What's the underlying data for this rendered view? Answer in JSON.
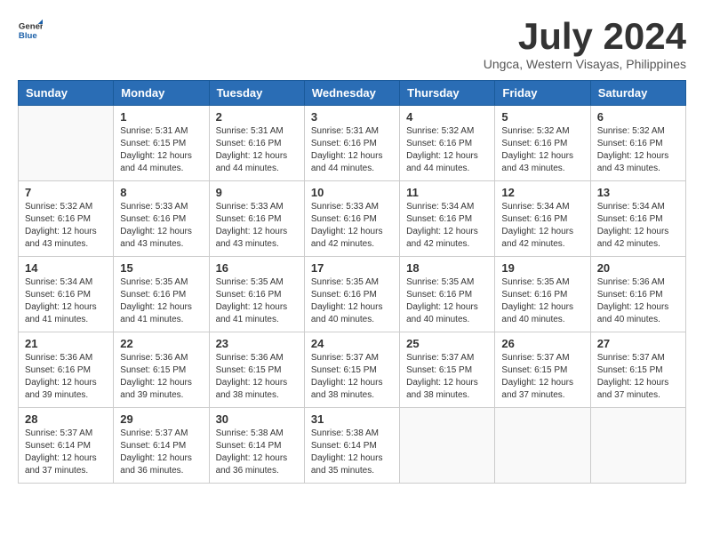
{
  "logo": {
    "line1": "General",
    "line2": "Blue"
  },
  "title": "July 2024",
  "location": "Ungca, Western Visayas, Philippines",
  "weekdays": [
    "Sunday",
    "Monday",
    "Tuesday",
    "Wednesday",
    "Thursday",
    "Friday",
    "Saturday"
  ],
  "weeks": [
    [
      {
        "day": "",
        "sunrise": "",
        "sunset": "",
        "daylight": ""
      },
      {
        "day": "1",
        "sunrise": "Sunrise: 5:31 AM",
        "sunset": "Sunset: 6:15 PM",
        "daylight": "Daylight: 12 hours and 44 minutes."
      },
      {
        "day": "2",
        "sunrise": "Sunrise: 5:31 AM",
        "sunset": "Sunset: 6:16 PM",
        "daylight": "Daylight: 12 hours and 44 minutes."
      },
      {
        "day": "3",
        "sunrise": "Sunrise: 5:31 AM",
        "sunset": "Sunset: 6:16 PM",
        "daylight": "Daylight: 12 hours and 44 minutes."
      },
      {
        "day": "4",
        "sunrise": "Sunrise: 5:32 AM",
        "sunset": "Sunset: 6:16 PM",
        "daylight": "Daylight: 12 hours and 44 minutes."
      },
      {
        "day": "5",
        "sunrise": "Sunrise: 5:32 AM",
        "sunset": "Sunset: 6:16 PM",
        "daylight": "Daylight: 12 hours and 43 minutes."
      },
      {
        "day": "6",
        "sunrise": "Sunrise: 5:32 AM",
        "sunset": "Sunset: 6:16 PM",
        "daylight": "Daylight: 12 hours and 43 minutes."
      }
    ],
    [
      {
        "day": "7",
        "sunrise": "Sunrise: 5:32 AM",
        "sunset": "Sunset: 6:16 PM",
        "daylight": "Daylight: 12 hours and 43 minutes."
      },
      {
        "day": "8",
        "sunrise": "Sunrise: 5:33 AM",
        "sunset": "Sunset: 6:16 PM",
        "daylight": "Daylight: 12 hours and 43 minutes."
      },
      {
        "day": "9",
        "sunrise": "Sunrise: 5:33 AM",
        "sunset": "Sunset: 6:16 PM",
        "daylight": "Daylight: 12 hours and 43 minutes."
      },
      {
        "day": "10",
        "sunrise": "Sunrise: 5:33 AM",
        "sunset": "Sunset: 6:16 PM",
        "daylight": "Daylight: 12 hours and 42 minutes."
      },
      {
        "day": "11",
        "sunrise": "Sunrise: 5:34 AM",
        "sunset": "Sunset: 6:16 PM",
        "daylight": "Daylight: 12 hours and 42 minutes."
      },
      {
        "day": "12",
        "sunrise": "Sunrise: 5:34 AM",
        "sunset": "Sunset: 6:16 PM",
        "daylight": "Daylight: 12 hours and 42 minutes."
      },
      {
        "day": "13",
        "sunrise": "Sunrise: 5:34 AM",
        "sunset": "Sunset: 6:16 PM",
        "daylight": "Daylight: 12 hours and 42 minutes."
      }
    ],
    [
      {
        "day": "14",
        "sunrise": "Sunrise: 5:34 AM",
        "sunset": "Sunset: 6:16 PM",
        "daylight": "Daylight: 12 hours and 41 minutes."
      },
      {
        "day": "15",
        "sunrise": "Sunrise: 5:35 AM",
        "sunset": "Sunset: 6:16 PM",
        "daylight": "Daylight: 12 hours and 41 minutes."
      },
      {
        "day": "16",
        "sunrise": "Sunrise: 5:35 AM",
        "sunset": "Sunset: 6:16 PM",
        "daylight": "Daylight: 12 hours and 41 minutes."
      },
      {
        "day": "17",
        "sunrise": "Sunrise: 5:35 AM",
        "sunset": "Sunset: 6:16 PM",
        "daylight": "Daylight: 12 hours and 40 minutes."
      },
      {
        "day": "18",
        "sunrise": "Sunrise: 5:35 AM",
        "sunset": "Sunset: 6:16 PM",
        "daylight": "Daylight: 12 hours and 40 minutes."
      },
      {
        "day": "19",
        "sunrise": "Sunrise: 5:35 AM",
        "sunset": "Sunset: 6:16 PM",
        "daylight": "Daylight: 12 hours and 40 minutes."
      },
      {
        "day": "20",
        "sunrise": "Sunrise: 5:36 AM",
        "sunset": "Sunset: 6:16 PM",
        "daylight": "Daylight: 12 hours and 40 minutes."
      }
    ],
    [
      {
        "day": "21",
        "sunrise": "Sunrise: 5:36 AM",
        "sunset": "Sunset: 6:16 PM",
        "daylight": "Daylight: 12 hours and 39 minutes."
      },
      {
        "day": "22",
        "sunrise": "Sunrise: 5:36 AM",
        "sunset": "Sunset: 6:15 PM",
        "daylight": "Daylight: 12 hours and 39 minutes."
      },
      {
        "day": "23",
        "sunrise": "Sunrise: 5:36 AM",
        "sunset": "Sunset: 6:15 PM",
        "daylight": "Daylight: 12 hours and 38 minutes."
      },
      {
        "day": "24",
        "sunrise": "Sunrise: 5:37 AM",
        "sunset": "Sunset: 6:15 PM",
        "daylight": "Daylight: 12 hours and 38 minutes."
      },
      {
        "day": "25",
        "sunrise": "Sunrise: 5:37 AM",
        "sunset": "Sunset: 6:15 PM",
        "daylight": "Daylight: 12 hours and 38 minutes."
      },
      {
        "day": "26",
        "sunrise": "Sunrise: 5:37 AM",
        "sunset": "Sunset: 6:15 PM",
        "daylight": "Daylight: 12 hours and 37 minutes."
      },
      {
        "day": "27",
        "sunrise": "Sunrise: 5:37 AM",
        "sunset": "Sunset: 6:15 PM",
        "daylight": "Daylight: 12 hours and 37 minutes."
      }
    ],
    [
      {
        "day": "28",
        "sunrise": "Sunrise: 5:37 AM",
        "sunset": "Sunset: 6:14 PM",
        "daylight": "Daylight: 12 hours and 37 minutes."
      },
      {
        "day": "29",
        "sunrise": "Sunrise: 5:37 AM",
        "sunset": "Sunset: 6:14 PM",
        "daylight": "Daylight: 12 hours and 36 minutes."
      },
      {
        "day": "30",
        "sunrise": "Sunrise: 5:38 AM",
        "sunset": "Sunset: 6:14 PM",
        "daylight": "Daylight: 12 hours and 36 minutes."
      },
      {
        "day": "31",
        "sunrise": "Sunrise: 5:38 AM",
        "sunset": "Sunset: 6:14 PM",
        "daylight": "Daylight: 12 hours and 35 minutes."
      },
      {
        "day": "",
        "sunrise": "",
        "sunset": "",
        "daylight": ""
      },
      {
        "day": "",
        "sunrise": "",
        "sunset": "",
        "daylight": ""
      },
      {
        "day": "",
        "sunrise": "",
        "sunset": "",
        "daylight": ""
      }
    ]
  ]
}
